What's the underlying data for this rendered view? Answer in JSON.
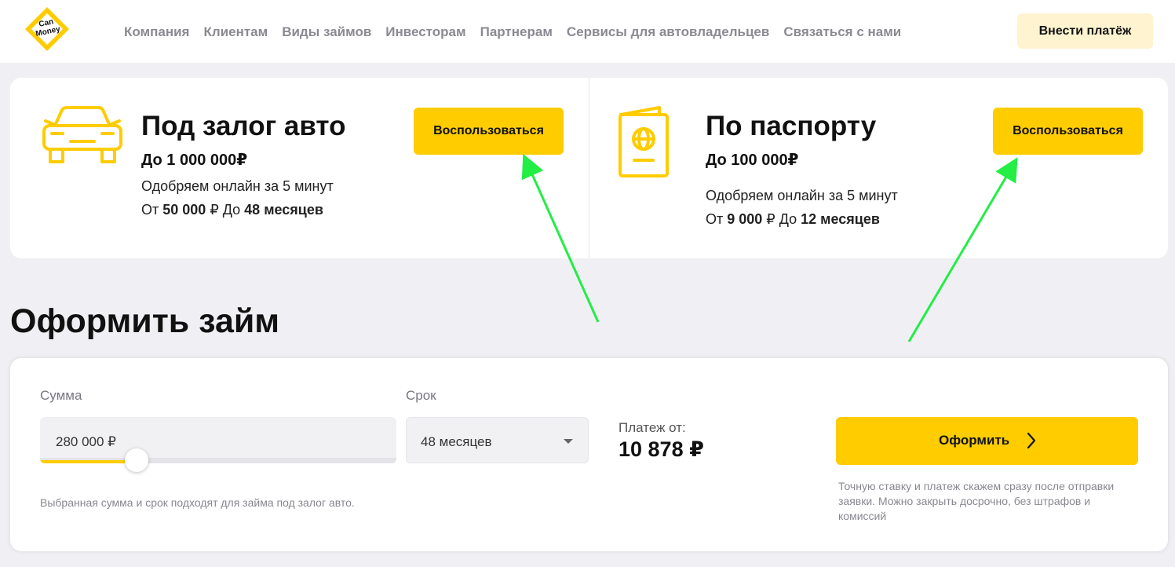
{
  "brand": {
    "logo_text_1": "Can",
    "logo_text_2": "Money",
    "accent_color": "#ffcc00",
    "annotation_color": "#22ee44"
  },
  "header": {
    "nav": [
      "Компания",
      "Клиентам",
      "Виды займов",
      "Инвесторам",
      "Партнерам",
      "Сервисы для автовладельцев",
      "Связаться с нами"
    ],
    "pay_button": "Внести платёж"
  },
  "products": [
    {
      "icon": "car-icon",
      "title": "Под залог авто",
      "max": "До 1 000 000₽",
      "desc": "Одобряем онлайн за 5 минут",
      "from_prefix": "От ",
      "from_amount": "50 000",
      "to_prefix": " ₽ До ",
      "to_term": "48 месяцев",
      "button": "Воспользоваться"
    },
    {
      "icon": "passport-icon",
      "title": "По паспорту",
      "max": "До 100 000₽",
      "desc": "Одобряем онлайн за 5 минут",
      "from_prefix": "От ",
      "from_amount": "9 000",
      "to_prefix": " ₽ До ",
      "to_term": "12 месяцев",
      "button": "Воспользоваться"
    }
  ],
  "loan_form": {
    "title": "Оформить займ",
    "sum_label": "Сумма",
    "sum_value": "280 000 ₽",
    "sum_slider_fraction": 0.27,
    "term_label": "Срок",
    "term_value": "48 месяцев",
    "payment_label": "Платеж от:",
    "payment_value": "10 878 ₽",
    "submit_button": "Оформить",
    "note_right": "Точную ставку и платеж скажем сразу после отправки заявки. Можно закрыть досрочно, без штрафов и комиссий",
    "note_left": "Выбранная сумма и срок подходят для займа под залог авто."
  }
}
